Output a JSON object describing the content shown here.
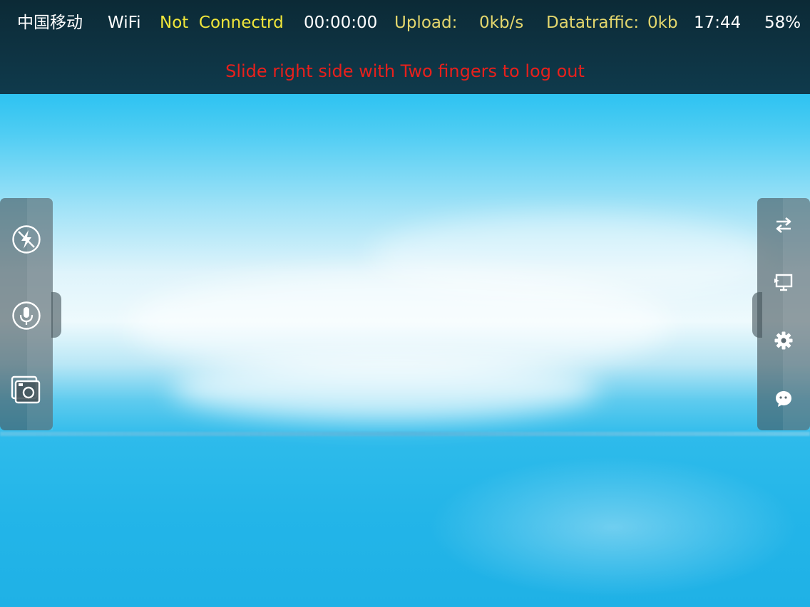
{
  "status_bar": {
    "carrier": "中国移动",
    "network": "WiFi",
    "connection_status": "Not  Connectrd",
    "timer": "00:00:00",
    "upload_label": "Upload:",
    "upload_value": "0kb/s",
    "datatraffic_label": "Datatraffic:",
    "datatraffic_value": "0kb",
    "clock": "17:44",
    "battery": "58%"
  },
  "notice": {
    "text": "Slide right side with Two fingers to log out",
    "color": "#e8201c"
  },
  "left_panel": {
    "items": [
      {
        "icon": "flash-off-icon"
      },
      {
        "icon": "microphone-icon"
      },
      {
        "icon": "photo-camera-icon"
      }
    ]
  },
  "right_panel": {
    "items": [
      {
        "icon": "switch-arrows-icon"
      },
      {
        "icon": "screen-display-icon"
      },
      {
        "icon": "gear-icon"
      },
      {
        "icon": "chat-bubble-icon"
      }
    ]
  },
  "colors": {
    "topbar": "#0c2a36",
    "connection_text": "#f0e63a",
    "label_text": "#e3d66d",
    "sky": "#15b8ec"
  }
}
